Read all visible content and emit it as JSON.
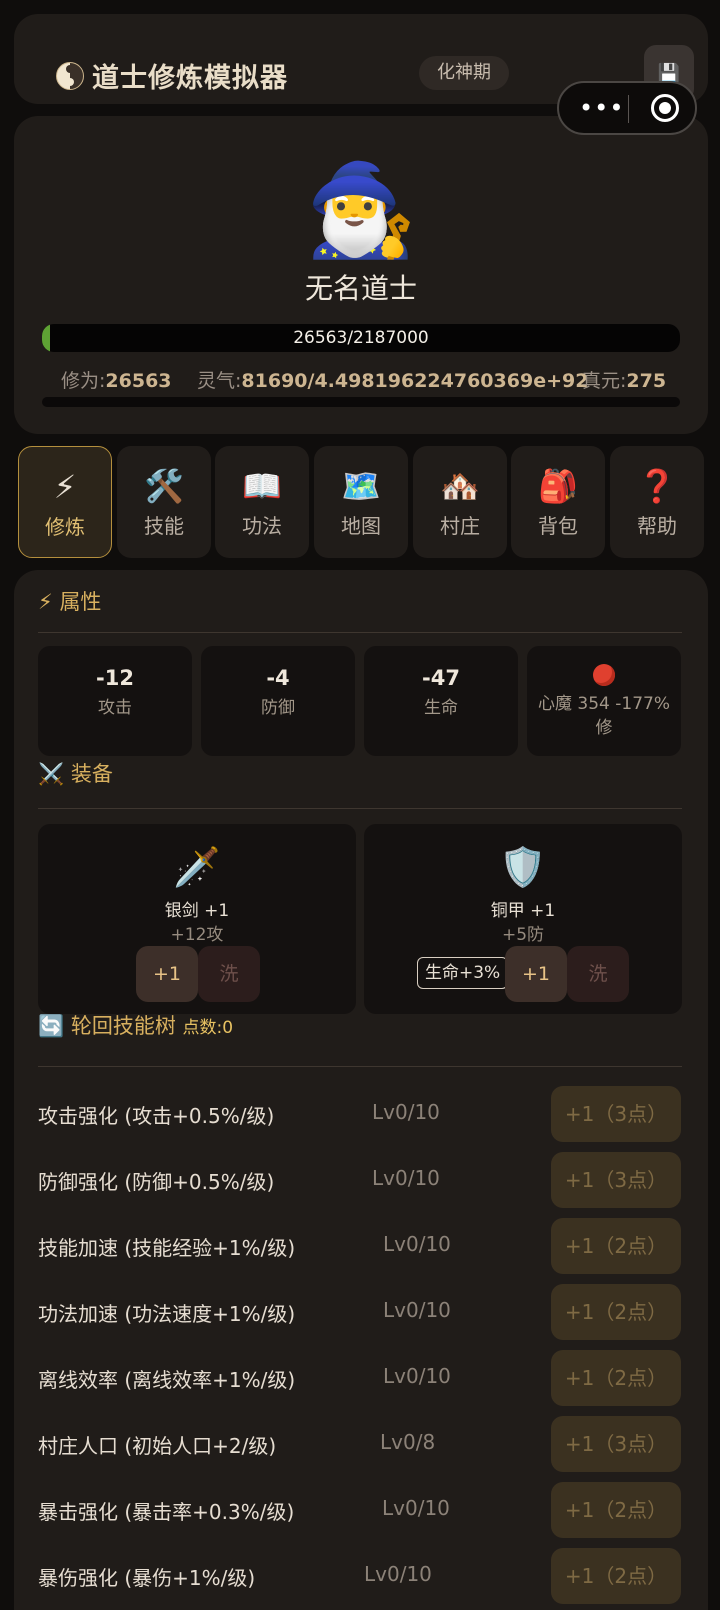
{
  "header": {
    "title": "道士修炼模拟器",
    "realm": "化神期",
    "save_icon": "💾",
    "capsule_more": "•••"
  },
  "profile": {
    "avatar": "🧙‍♂️",
    "name": "无名道士",
    "exp_text": "26563/2187000",
    "exp_progress": 0.012,
    "stats": {
      "cultivation_label": "修为:",
      "cultivation_value": "26563",
      "qi_label": "灵气:",
      "qi_value": "81690/4.498196224760369e+92",
      "zhenyuan_label": "真元:",
      "zhenyuan_value": "275"
    }
  },
  "tabs": [
    {
      "icon": "⚡",
      "label": "修炼",
      "active": true
    },
    {
      "icon": "🛠️",
      "label": "技能"
    },
    {
      "icon": "📖",
      "label": "功法"
    },
    {
      "icon": "🗺️",
      "label": "地图"
    },
    {
      "icon": "🏘️",
      "label": "村庄"
    },
    {
      "icon": "🎒",
      "label": "背包"
    },
    {
      "icon": "❓",
      "label": "帮助"
    }
  ],
  "attributes": {
    "title_icon": "⚡",
    "title": "属性",
    "items": [
      {
        "value": "-12",
        "label": "攻击"
      },
      {
        "value": "-4",
        "label": "防御"
      },
      {
        "value": "-47",
        "label": "生命"
      }
    ],
    "demon": {
      "label": "心魔 354 -177%修"
    }
  },
  "equipment": {
    "title_icon": "⚔️",
    "title": "装备",
    "weapon": {
      "icon": "🗡️",
      "name": "银剑 +1",
      "stat": "+12攻",
      "plus": "+1",
      "wash": "洗"
    },
    "armor": {
      "icon": "🛡️",
      "name": "铜甲 +1",
      "stat": "+5防",
      "badge": "生命+3%",
      "plus": "+1",
      "wash": "洗"
    }
  },
  "skill_tree": {
    "title_icon": "🔄",
    "title": "轮回技能树",
    "points": "点数:0",
    "items": [
      {
        "name": "攻击强化 (攻击+0.5%/级)",
        "level": "Lv0/10",
        "button": "+1（3点）"
      },
      {
        "name": "防御强化 (防御+0.5%/级)",
        "level": "Lv0/10",
        "button": "+1（3点）"
      },
      {
        "name": "技能加速 (技能经验+1%/级)",
        "level": "Lv0/10",
        "button": "+1（2点）"
      },
      {
        "name": "功法加速 (功法速度+1%/级)",
        "level": "Lv0/10",
        "button": "+1（2点）"
      },
      {
        "name": "离线效率 (离线效率+1%/级)",
        "level": "Lv0/10",
        "button": "+1（2点）"
      },
      {
        "name": "村庄人口 (初始人口+2/级)",
        "level": "Lv0/8",
        "button": "+1（3点）"
      },
      {
        "name": "暴击强化 (暴击率+0.3%/级)",
        "level": "Lv0/10",
        "button": "+1（2点）"
      },
      {
        "name": "暴伤强化 (暴伤+1%/级)",
        "level": "Lv0/10",
        "button": "+1（2点）"
      }
    ]
  }
}
